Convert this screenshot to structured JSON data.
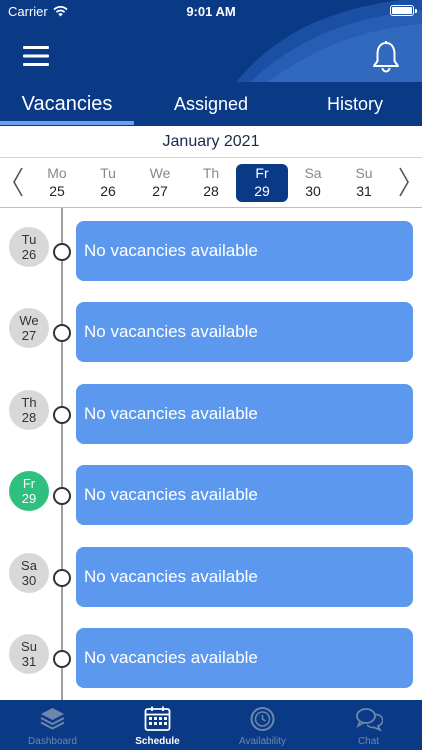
{
  "status_bar": {
    "carrier": "Carrier",
    "time": "9:01 AM"
  },
  "header": {
    "menu_icon": "hamburger-menu-icon",
    "bell_icon": "bell-icon"
  },
  "tabs": [
    {
      "label": "Vacancies",
      "active": true
    },
    {
      "label": "Assigned",
      "active": false
    },
    {
      "label": "History",
      "active": false
    }
  ],
  "month": "January 2021",
  "week": [
    {
      "name": "Mo",
      "date": "25",
      "selected": false
    },
    {
      "name": "Tu",
      "date": "26",
      "selected": false
    },
    {
      "name": "We",
      "date": "27",
      "selected": false
    },
    {
      "name": "Th",
      "date": "28",
      "selected": false
    },
    {
      "name": "Fr",
      "date": "29",
      "selected": true
    },
    {
      "name": "Sa",
      "date": "30",
      "selected": false
    },
    {
      "name": "Su",
      "date": "31",
      "selected": false
    }
  ],
  "timeline": [
    {
      "day": "Tu",
      "date": "26",
      "today": false,
      "message": "No vacancies available"
    },
    {
      "day": "We",
      "date": "27",
      "today": false,
      "message": "No vacancies available"
    },
    {
      "day": "Th",
      "date": "28",
      "today": false,
      "message": "No vacancies available"
    },
    {
      "day": "Fr",
      "date": "29",
      "today": true,
      "message": "No vacancies available"
    },
    {
      "day": "Sa",
      "date": "30",
      "today": false,
      "message": "No vacancies available"
    },
    {
      "day": "Su",
      "date": "31",
      "today": false,
      "message": "No vacancies available"
    }
  ],
  "bottom_nav": [
    {
      "label": "Dashboard",
      "icon": "layers-icon",
      "active": false
    },
    {
      "label": "Schedule",
      "icon": "calendar-icon",
      "active": true
    },
    {
      "label": "Availability",
      "icon": "clock-icon",
      "active": false
    },
    {
      "label": "Chat",
      "icon": "chat-bubbles-icon",
      "active": false
    }
  ],
  "colors": {
    "primary": "#0a3a86",
    "card": "#5c99ee",
    "today": "#2fbf7f",
    "tab_underline": "#6aa0ec"
  }
}
